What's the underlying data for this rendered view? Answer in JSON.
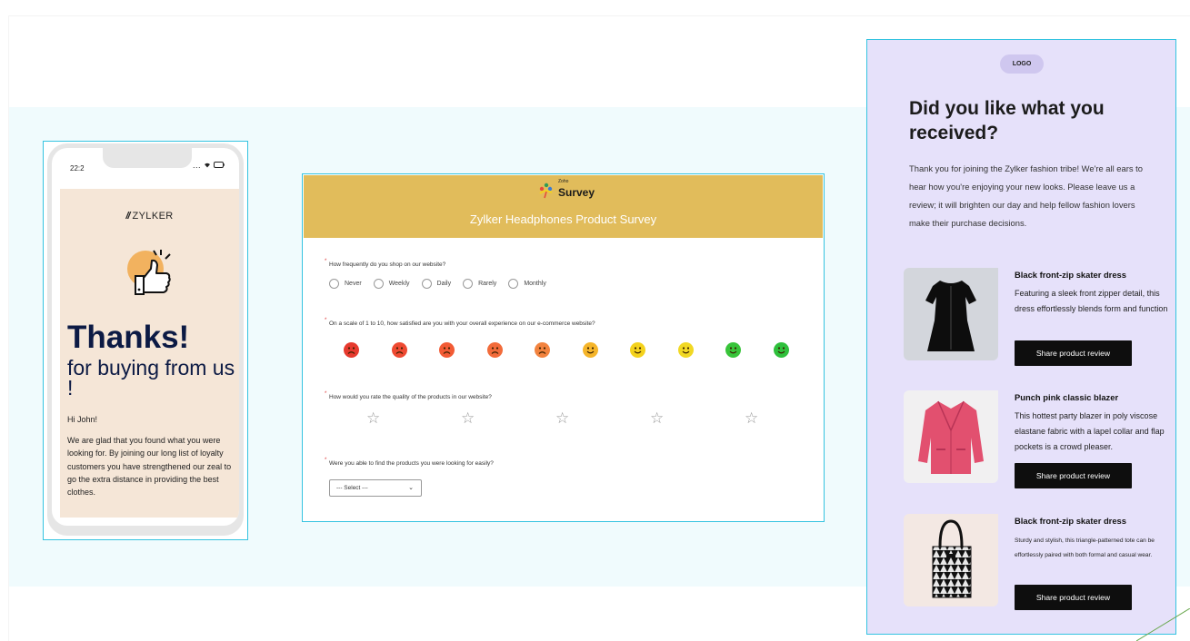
{
  "phone": {
    "time": "22:2",
    "status": "...",
    "brand": "ZYLKER",
    "thanks": "Thanks!",
    "subtitle": "for buying from us !",
    "greeting": "Hi John!",
    "body": "We are glad that you found what you were looking for. By joining our long list of loyalty customers you have strengthened our zeal to go the extra distance in providing the best clothes."
  },
  "survey": {
    "brand_small": "Zoho",
    "brand": "Survey",
    "title": "Zylker Headphones Product Survey",
    "q1": "How frequently do you shop on our website?",
    "q1_options": [
      "Never",
      "Weekly",
      "Daily",
      "Rarely",
      "Monthly"
    ],
    "q2": "On a scale of 1 to 10, how satisfied are you with your overall experience on our e-commerce website?",
    "q3": "How would you rate the quality of the products in our website?",
    "q4": "Were you able to find the products you were looking for easily?",
    "select_value": "--- Select ---",
    "face_colors": [
      "#e63a2e",
      "#ee4a32",
      "#f25b35",
      "#f26b3a",
      "#f2833f",
      "#f5b52a",
      "#f4d21c",
      "#f1d824",
      "#38c43a",
      "#2fc03c"
    ]
  },
  "review": {
    "logo": "LOGO",
    "title": "Did you like what you received?",
    "body": "Thank you for joining the Zylker fashion tribe! We're all ears to hear how you're enjoying your new looks. Please leave us a review; it will brighten our day and help fellow fashion lovers make their purchase decisions.",
    "products": [
      {
        "name": "Black front-zip skater dress",
        "desc": "Featuring a sleek front zipper detail, this dress effortlessly blends form and function",
        "button": "Share product review"
      },
      {
        "name": "Punch pink classic blazer",
        "desc": "This hottest party blazer in poly viscose elastane fabric with a lapel collar and flap pockets is a crowd pleaser.",
        "button": "Share product review"
      },
      {
        "name": "Black front-zip skater dress",
        "desc": "Sturdy and stylish, this triangle-patterned tote can be effortlessly paired with both formal and casual wear.",
        "button": "Share product review"
      }
    ]
  }
}
